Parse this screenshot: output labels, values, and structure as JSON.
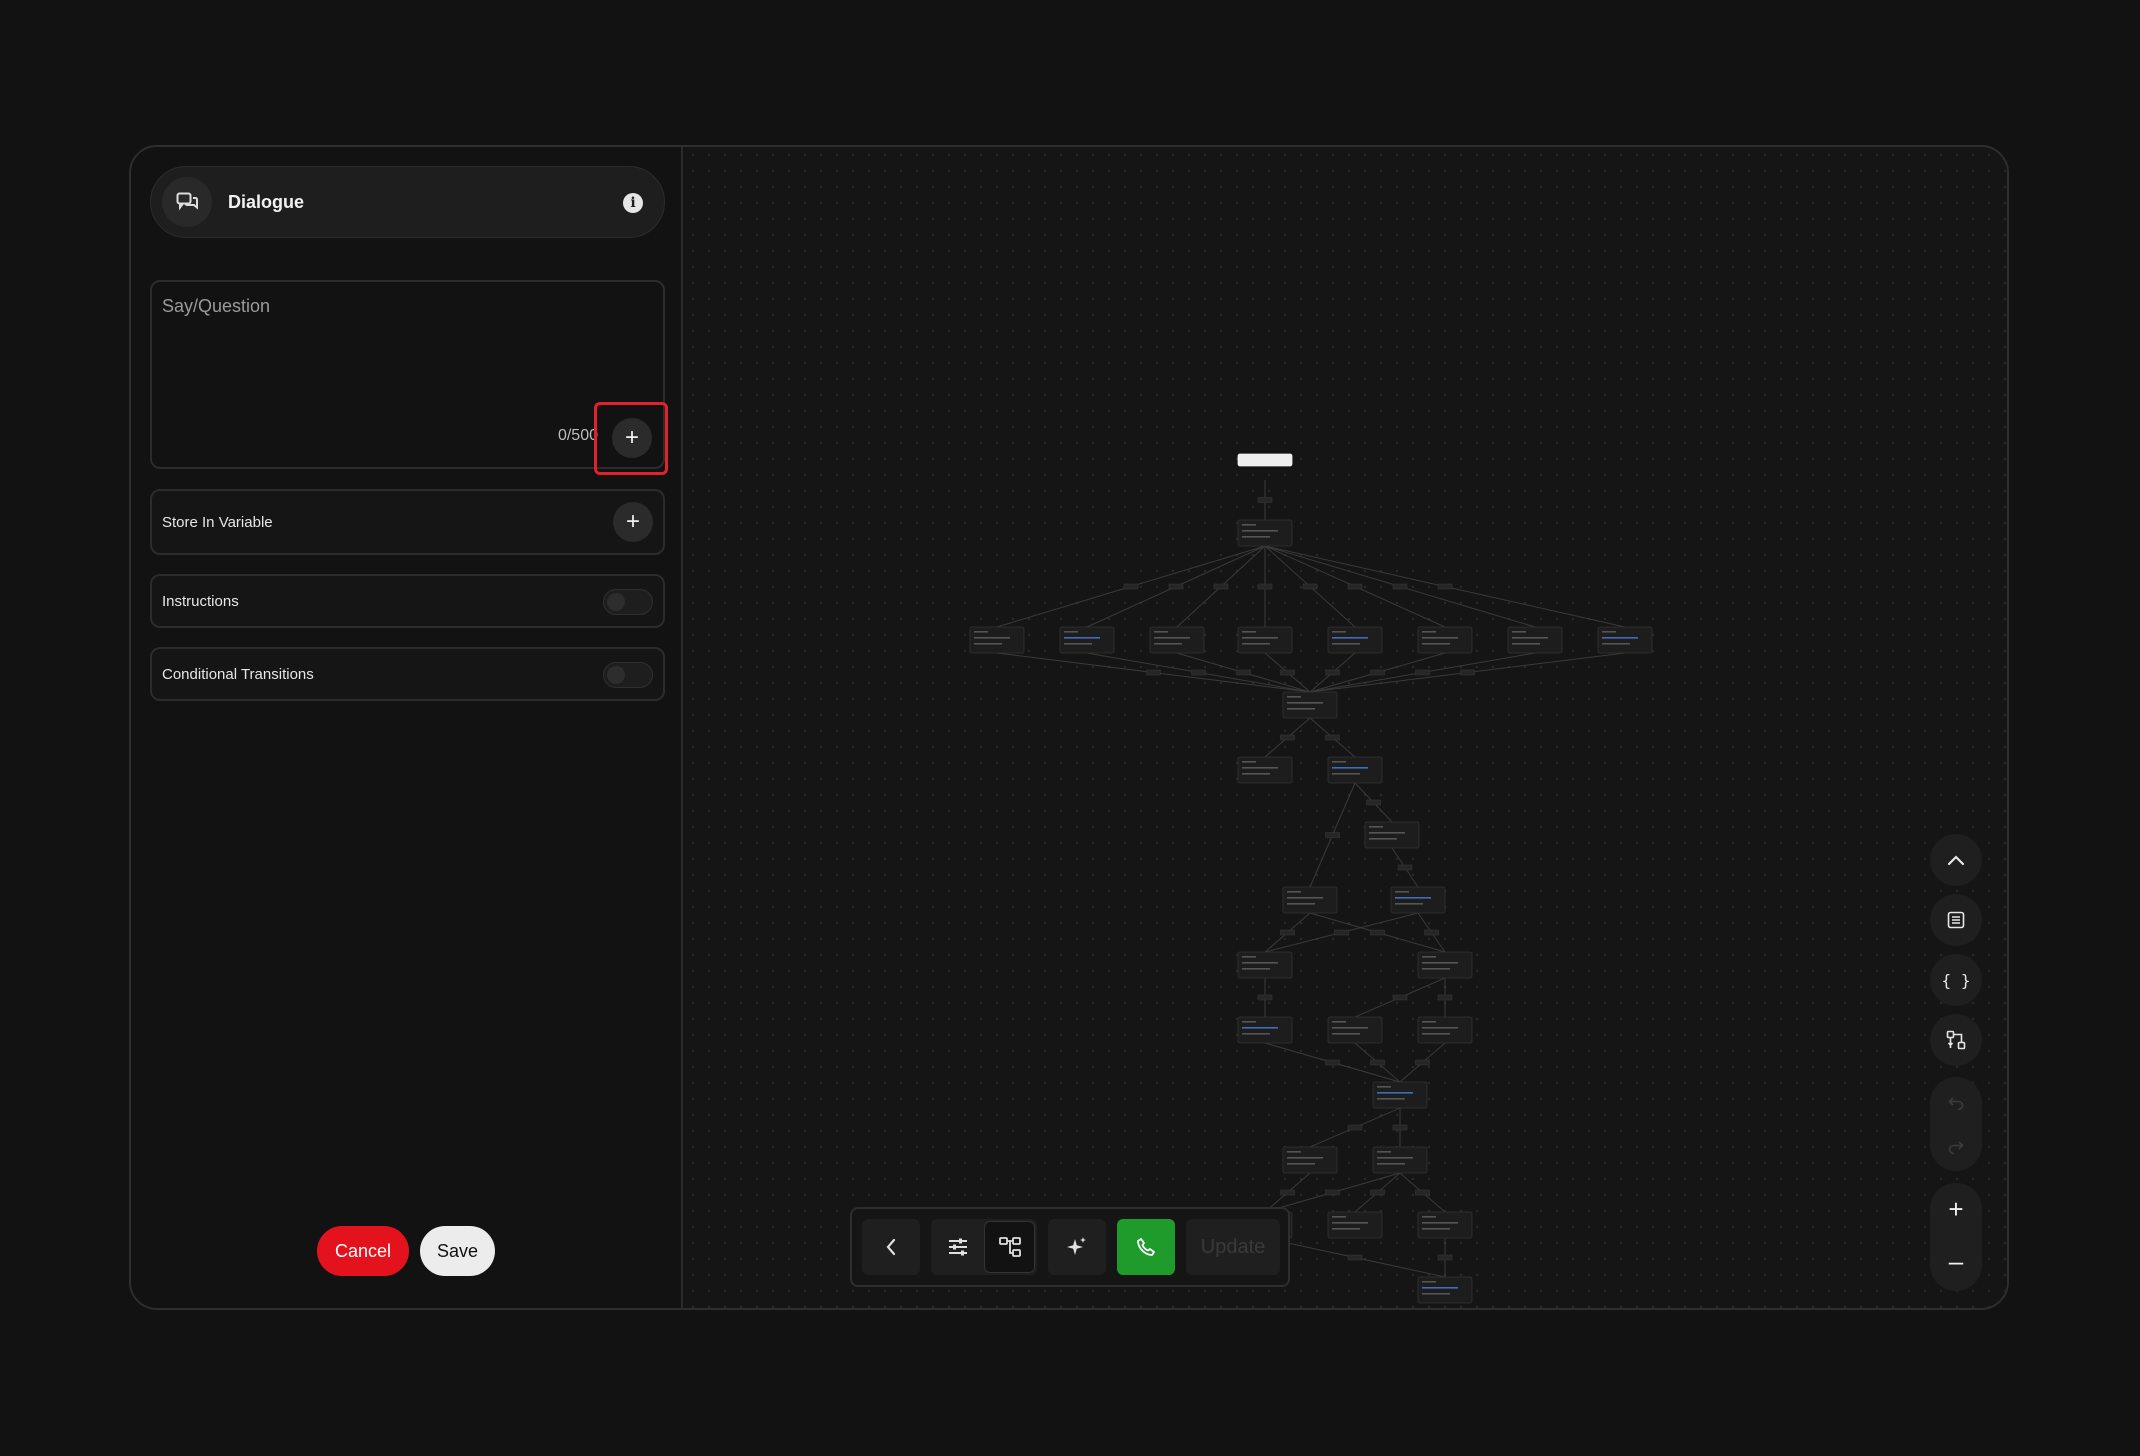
{
  "dialog": {
    "title": "Dialogue",
    "info_icon": "info-icon",
    "header_icon": "dialogue-icon"
  },
  "say": {
    "placeholder": "Say/Question",
    "char_count": "0/500",
    "add_icon": "+"
  },
  "store_variable": {
    "label": "Store In Variable",
    "add_icon": "+"
  },
  "instructions": {
    "label": "Instructions",
    "enabled": false
  },
  "conditional": {
    "label": "Conditional Transitions",
    "enabled": false
  },
  "actions": {
    "cancel": "Cancel",
    "save": "Save"
  },
  "toolbar": {
    "back_icon": "chevron-left-icon",
    "settings_icon": "sliders-icon",
    "flow_icon": "flow-tree-icon",
    "ai_icon": "sparkle-icon",
    "call_icon": "phone-icon",
    "update_label": "Update"
  },
  "side_controls": {
    "up_icon": "chevron-up-icon",
    "notes_icon": "list-icon",
    "variables_icon": "braces-icon",
    "layout_icon": "auto-layout-icon",
    "undo_icon": "undo-icon",
    "redo_icon": "redo-icon",
    "zoom_in": "+",
    "zoom_out": "–"
  },
  "colors": {
    "accent_red": "#e4121d",
    "call_green": "#1e9b2b",
    "highlight": "#e3202b"
  }
}
